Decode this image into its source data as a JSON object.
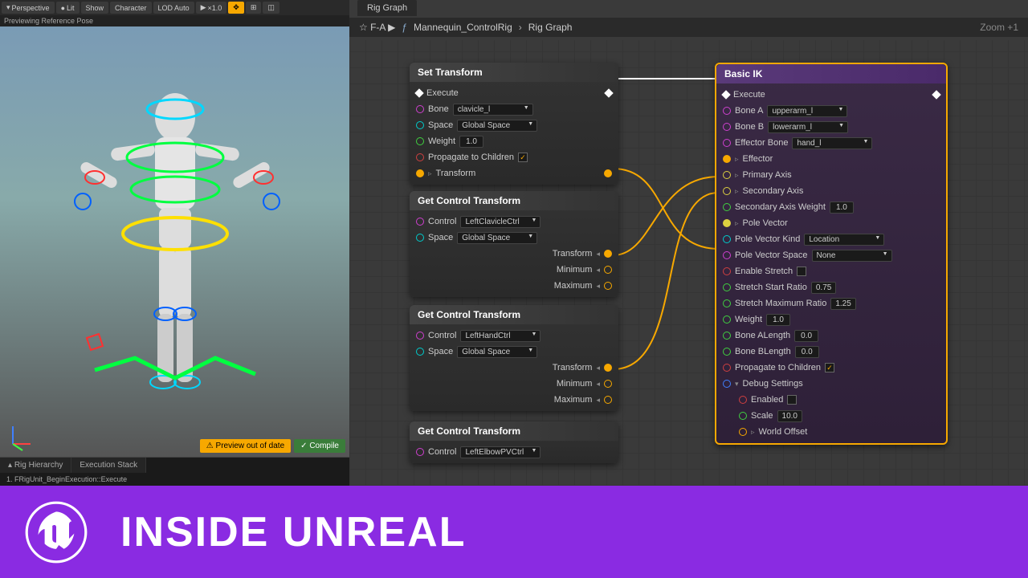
{
  "toolbar": {
    "perspective": "Perspective",
    "lit": "Lit",
    "show": "Show",
    "character": "Character",
    "lod": "LOD Auto",
    "speed": "×1.0"
  },
  "preview_note": "Previewing Reference Pose",
  "viewport": {
    "warn_btn": "Preview out of date",
    "compile_btn": "Compile"
  },
  "left_tabs": {
    "hierarchy": "Rig Hierarchy",
    "exec": "Execution Stack"
  },
  "exec_item": "1. FRigUnit_BeginExecution::Execute",
  "rg_tab": "Rig Graph",
  "breadcrumb": {
    "brand": "F-A",
    "asset": "Mannequin_ControlRig",
    "graph": "Rig Graph",
    "zoom": "Zoom +1"
  },
  "nodes": {
    "setTransform": {
      "title": "Set Transform",
      "execute": "Execute",
      "bone_label": "Bone",
      "bone_val": "clavicle_l",
      "space_label": "Space",
      "space_val": "Global Space",
      "weight_label": "Weight",
      "weight_val": "1.0",
      "propagate_label": "Propagate to Children",
      "transform_label": "Transform"
    },
    "gct1": {
      "title": "Get Control Transform",
      "control_label": "Control",
      "control_val": "LeftClavicleCtrl",
      "space_label": "Space",
      "space_val": "Global Space",
      "transform": "Transform",
      "min": "Minimum",
      "max": "Maximum"
    },
    "gct2": {
      "title": "Get Control Transform",
      "control_label": "Control",
      "control_val": "LeftHandCtrl",
      "space_label": "Space",
      "space_val": "Global Space",
      "transform": "Transform",
      "min": "Minimum",
      "max": "Maximum"
    },
    "gct3": {
      "title": "Get Control Transform",
      "control_label": "Control",
      "control_val": "LeftElbowPVCtrl"
    },
    "ik": {
      "title": "Basic IK",
      "execute": "Execute",
      "boneA_label": "Bone A",
      "boneA_val": "upperarm_l",
      "boneB_label": "Bone B",
      "boneB_val": "lowerarm_l",
      "effector_label": "Effector Bone",
      "effector_val": "hand_l",
      "effector_pin": "Effector",
      "primary_axis": "Primary Axis",
      "secondary_axis": "Secondary Axis",
      "sec_axis_weight_label": "Secondary Axis Weight",
      "sec_axis_weight_val": "1.0",
      "pole_vector": "Pole Vector",
      "pole_kind_label": "Pole Vector Kind",
      "pole_kind_val": "Location",
      "pole_space_label": "Pole Vector Space",
      "pole_space_val": "None",
      "enable_stretch": "Enable Stretch",
      "stretch_start_label": "Stretch Start Ratio",
      "stretch_start_val": "0.75",
      "stretch_max_label": "Stretch Maximum Ratio",
      "stretch_max_val": "1.25",
      "weight_label": "Weight",
      "weight_val": "1.0",
      "boneAlen_label": "Bone ALength",
      "boneAlen_val": "0.0",
      "boneBlen_label": "Bone BLength",
      "boneBlen_val": "0.0",
      "propagate": "Propagate to Children",
      "debug": "Debug Settings",
      "enabled": "Enabled",
      "scale_label": "Scale",
      "scale_val": "10.0",
      "world_offset": "World Offset"
    }
  },
  "footer": {
    "title": "INSIDE UNREAL"
  }
}
